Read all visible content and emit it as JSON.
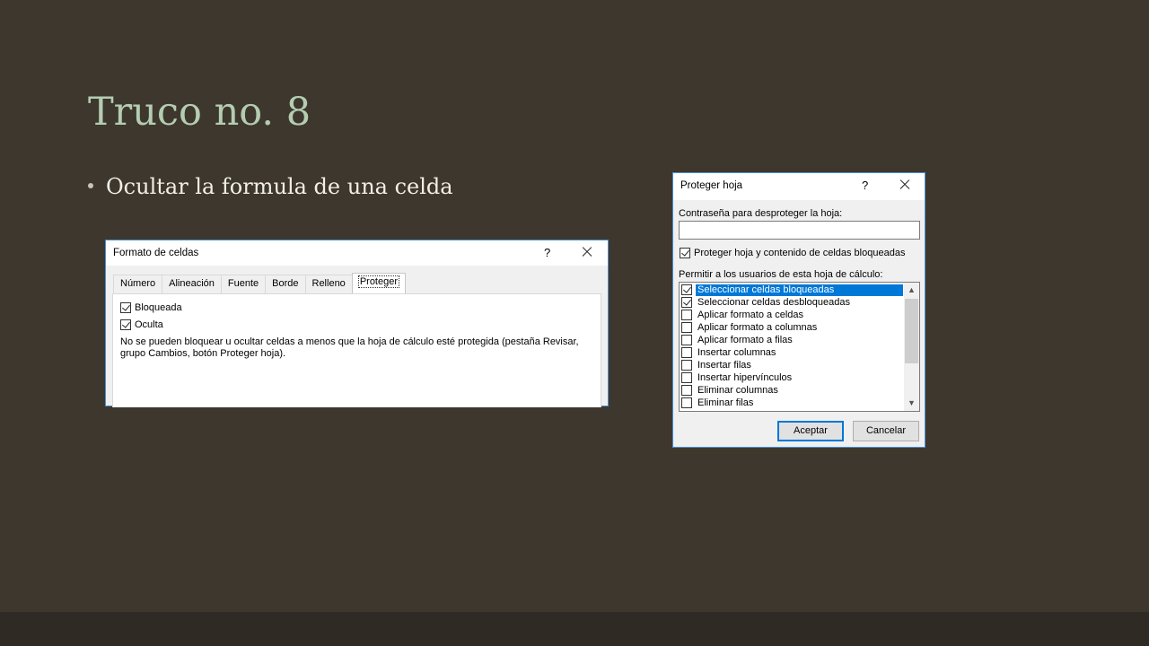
{
  "slide": {
    "title": "Truco no. 8",
    "bullet": "Ocultar la formula de una celda"
  },
  "format_dialog": {
    "title": "Formato de celdas",
    "help": "?",
    "tabs": [
      "Número",
      "Alineación",
      "Fuente",
      "Borde",
      "Relleno",
      "Proteger"
    ],
    "active_tab": "Proteger",
    "checkboxes": [
      {
        "label": "Bloqueada",
        "checked": true
      },
      {
        "label": "Oculta",
        "checked": true
      }
    ],
    "note": "No se pueden bloquear u ocultar celdas a menos que la hoja de cálculo esté protegida (pestaña Revisar, grupo Cambios, botón Proteger hoja)."
  },
  "protect_dialog": {
    "title": "Proteger hoja",
    "help": "?",
    "password_label": "Contraseña para desproteger la hoja:",
    "password_value": "",
    "protect_checkbox": {
      "label": "Proteger hoja y contenido de celdas bloqueadas",
      "checked": true
    },
    "allow_label": "Permitir a los usuarios de esta hoja de cálculo:",
    "items": [
      {
        "label": "Seleccionar celdas bloqueadas",
        "checked": true
      },
      {
        "label": "Seleccionar celdas desbloqueadas",
        "checked": true
      },
      {
        "label": "Aplicar formato a celdas",
        "checked": false
      },
      {
        "label": "Aplicar formato a columnas",
        "checked": false
      },
      {
        "label": "Aplicar formato a filas",
        "checked": false
      },
      {
        "label": "Insertar columnas",
        "checked": false
      },
      {
        "label": "Insertar filas",
        "checked": false
      },
      {
        "label": "Insertar hipervínculos",
        "checked": false
      },
      {
        "label": "Eliminar columnas",
        "checked": false
      },
      {
        "label": "Eliminar filas",
        "checked": false
      }
    ],
    "selected_item": "Seleccionar celdas bloqueadas",
    "ok_label": "Aceptar",
    "cancel_label": "Cancelar"
  },
  "colors": {
    "background": "#3e372e",
    "title": "#b4cdb1",
    "accent": "#0078d7"
  }
}
